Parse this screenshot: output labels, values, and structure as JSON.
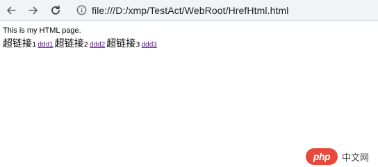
{
  "browser": {
    "url": "file:///D:/xmp/TestAct/WebRoot/HrefHtml.html",
    "icons": {
      "back": "arrow-left-icon",
      "forward": "arrow-right-icon",
      "reload": "reload-icon",
      "info": "info-icon"
    }
  },
  "page": {
    "intro": "This is my HTML page.",
    "links": [
      {
        "prefix": "超链接",
        "number": "1",
        "link": "ddd1"
      },
      {
        "prefix": "超链接",
        "number": "2",
        "link": "ddd2"
      },
      {
        "prefix": "超链接",
        "number": "3",
        "link": "ddd3"
      }
    ]
  },
  "watermark": {
    "logo": "php",
    "text": "中文网"
  },
  "colors": {
    "visited_link": "#551a8b",
    "toolbar_bg": "#f1f3f4",
    "php_brand": "#e7493c"
  }
}
